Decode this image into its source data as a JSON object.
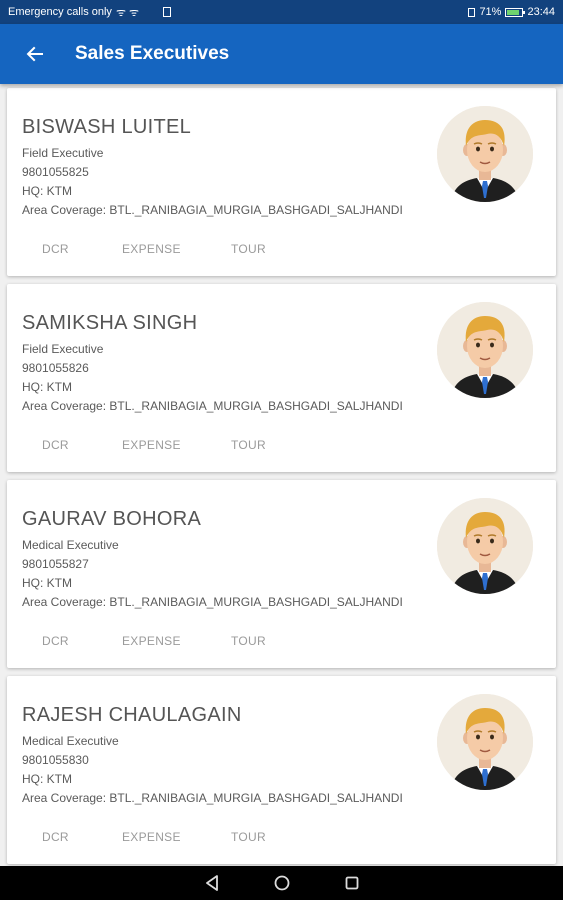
{
  "status_bar": {
    "left_text": "Emergency calls only",
    "signal_text": "ᯤ ᯤ",
    "battery_percent": "71%",
    "time": "23:44"
  },
  "app_bar": {
    "title": "Sales Executives",
    "back_icon": "arrow-back-icon"
  },
  "colors": {
    "status_bar": "#12427e",
    "app_bar": "#1565c0",
    "avatar_background": "#f1ebe1"
  },
  "executives": [
    {
      "name": "BISWASH LUITEL",
      "role": "Field Executive",
      "phone": "9801055825",
      "hq": "HQ: KTM",
      "area": "Area Coverage: BTL._RANIBAGIA_MURGIA_BASHGADI_SALJHANDI",
      "actions": [
        "DCR",
        "EXPENSE",
        "TOUR"
      ]
    },
    {
      "name": "SAMIKSHA SINGH",
      "role": "Field Executive",
      "phone": "9801055826",
      "hq": "HQ: KTM",
      "area": "Area Coverage: BTL._RANIBAGIA_MURGIA_BASHGADI_SALJHANDI",
      "actions": [
        "DCR",
        "EXPENSE",
        "TOUR"
      ]
    },
    {
      "name": "GAURAV BOHORA",
      "role": "Medical Executive",
      "phone": "9801055827",
      "hq": "HQ: KTM",
      "area": "Area Coverage: BTL._RANIBAGIA_MURGIA_BASHGADI_SALJHANDI",
      "actions": [
        "DCR",
        "EXPENSE",
        "TOUR"
      ]
    },
    {
      "name": "RAJESH CHAULAGAIN",
      "role": "Medical Executive",
      "phone": "9801055830",
      "hq": "HQ: KTM",
      "area": "Area Coverage: BTL._RANIBAGIA_MURGIA_BASHGADI_SALJHANDI",
      "actions": [
        "DCR",
        "EXPENSE",
        "TOUR"
      ]
    }
  ],
  "nav_bar": {
    "buttons": [
      "back-triangle-icon",
      "home-circle-icon",
      "recents-square-icon"
    ]
  }
}
